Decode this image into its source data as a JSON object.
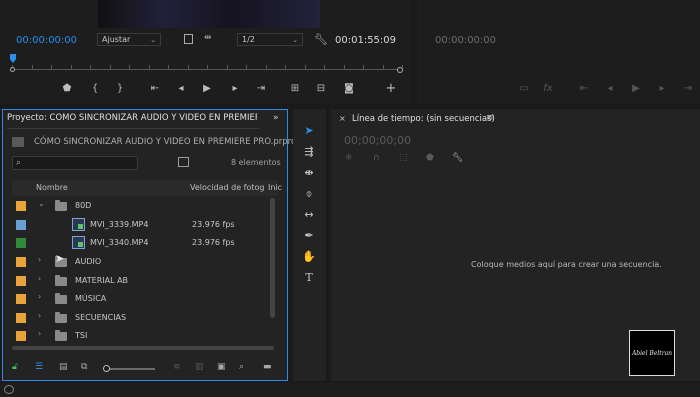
{
  "source_monitor": {
    "timecode_in": "00:00:00:00",
    "zoom_label": "Ajustar",
    "resolution_label": "1/2",
    "duration": "00:01:55:09"
  },
  "program_monitor": {
    "timecode": "00:00:00:00"
  },
  "project_panel": {
    "tab_title": "Proyecto: CÓMO SINCRONIZAR AUDIO Y VIDEO EN PREMIERE P",
    "project_file": "CÓMO SINCRONIZAR AUDIO Y VIDEO EN PREMIERE PRO.prproj",
    "search_placeholder": "",
    "item_count": "8 elementos",
    "columns": {
      "name": "Nombre",
      "fps": "Velocidad de fotog",
      "in": "Inic"
    },
    "rows": [
      {
        "name": "80D",
        "fps": "",
        "color": "#e8a33a",
        "type": "folder",
        "expanded": true
      },
      {
        "name": "MVI_3339.MP4",
        "fps": "23.976 fps",
        "color": "#6a9fd6",
        "type": "clip"
      },
      {
        "name": "MVI_3340.MP4",
        "fps": "23.976 fps",
        "color": "#2f8a3a",
        "type": "clip"
      },
      {
        "name": "AUDIO",
        "fps": "",
        "color": "#e8a33a",
        "type": "folder"
      },
      {
        "name": "MATERIAL AB",
        "fps": "",
        "color": "#e8a33a",
        "type": "folder"
      },
      {
        "name": "MÚSICA",
        "fps": "",
        "color": "#e8a33a",
        "type": "folder"
      },
      {
        "name": "SECUENCIAS",
        "fps": "",
        "color": "#e8a33a",
        "type": "folder"
      },
      {
        "name": "TSI",
        "fps": "",
        "color": "#e8a33a",
        "type": "folder"
      }
    ]
  },
  "timeline": {
    "tab_title": "Línea de tiempo: (sin secuencias)",
    "timecode": "00;00;00;00",
    "drop_hint": "Coloque medios aquí para crear una secuencia."
  },
  "watermark": {
    "text": "Abiel Beltran"
  },
  "colors": {
    "accent": "#2d8ceb",
    "lock_green": "#43c15a"
  }
}
